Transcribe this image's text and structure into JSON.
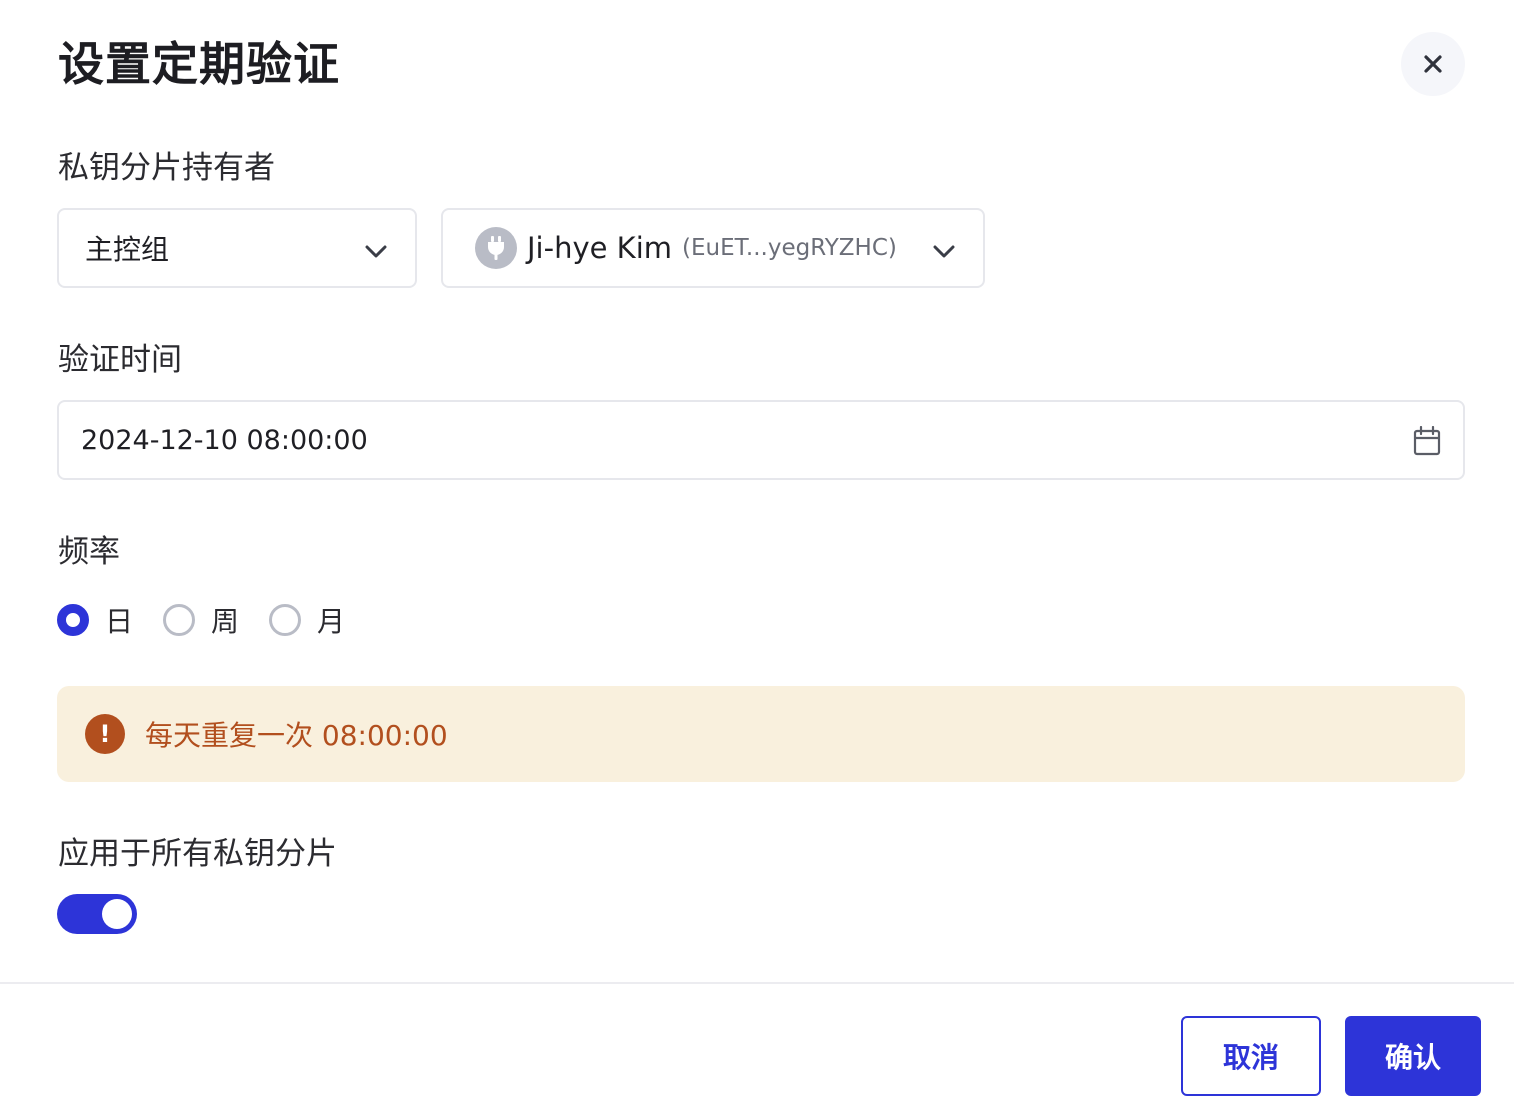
{
  "dialog": {
    "title": "设置定期验证"
  },
  "holder": {
    "label": "私钥分片持有者",
    "group_select": "主控组",
    "user_name": "Ji-hye Kim",
    "user_address": "(EuET...yegRYZHC)"
  },
  "time": {
    "label": "验证时间",
    "value": "2024-12-10 08:00:00"
  },
  "frequency": {
    "label": "频率",
    "options": [
      {
        "label": "日",
        "checked": true
      },
      {
        "label": "周",
        "checked": false
      },
      {
        "label": "月",
        "checked": false
      }
    ]
  },
  "notice": {
    "icon": "!",
    "text": "每天重复一次 08:00:00"
  },
  "apply_all": {
    "label": "应用于所有私钥分片",
    "enabled": true
  },
  "footer": {
    "cancel_label": "取消",
    "confirm_label": "确认"
  },
  "colors": {
    "primary": "#2d34d8",
    "warning_bg": "#f9f0dd",
    "warning_text": "#b24f1e"
  }
}
